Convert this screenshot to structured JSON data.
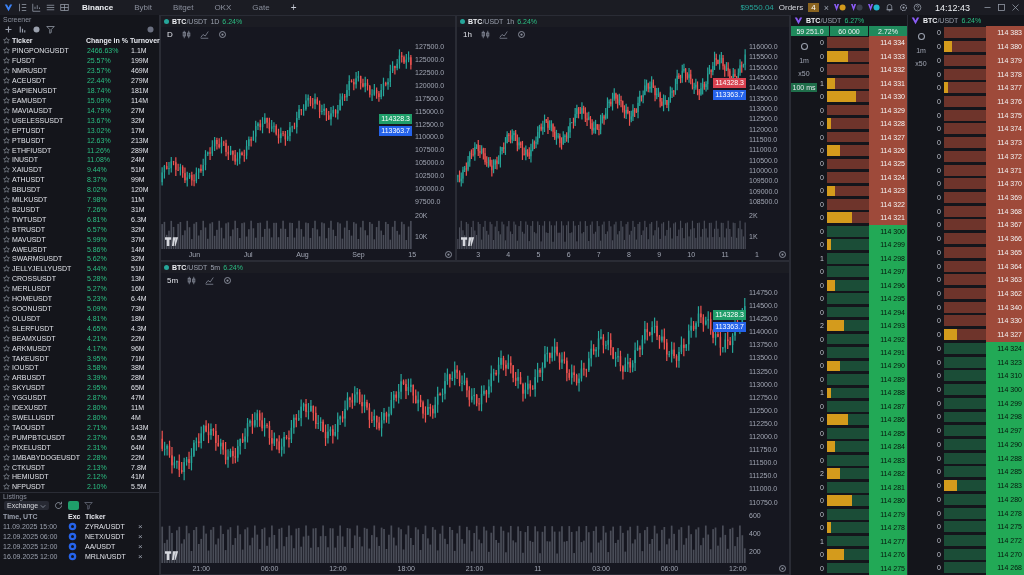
{
  "top_bar": {
    "tabs": [
      {
        "label": "Binance",
        "selected": true
      },
      {
        "label": "Bybit",
        "selected": false
      },
      {
        "label": "Bitget",
        "selected": false
      },
      {
        "label": "OKX",
        "selected": false
      },
      {
        "label": "Gate",
        "selected": false
      }
    ],
    "add_tab": "+",
    "balance": "$9550.04",
    "orders_label": "Orders",
    "orders_count": "4",
    "orders_close": "×",
    "clock": "14:12:43"
  },
  "screener": {
    "title": "Screener",
    "columns": [
      "Ticker",
      "Change in %",
      "Turnover"
    ],
    "rows": [
      {
        "ticker": "PINGPONGUSDT",
        "change": "2466.63%",
        "turnover": "1.1M"
      },
      {
        "ticker": "FUSDT",
        "change": "25.57%",
        "turnover": "199M"
      },
      {
        "ticker": "NMRUSDT",
        "change": "23.57%",
        "turnover": "469M"
      },
      {
        "ticker": "ACEUSDT",
        "change": "22.44%",
        "turnover": "279M"
      },
      {
        "ticker": "SAPIENUSDT",
        "change": "18.74%",
        "turnover": "181M"
      },
      {
        "ticker": "EAMUSDT",
        "change": "15.09%",
        "turnover": "114M"
      },
      {
        "ticker": "MAVIAUSDT",
        "change": "14.79%",
        "turnover": "27M"
      },
      {
        "ticker": "USELESSUSDT",
        "change": "13.67%",
        "turnover": "32M"
      },
      {
        "ticker": "EPTUSDT",
        "change": "13.02%",
        "turnover": "17M"
      },
      {
        "ticker": "PTBUSDT",
        "change": "12.63%",
        "turnover": "213M"
      },
      {
        "ticker": "ETHFIUSDT",
        "change": "11.26%",
        "turnover": "289M"
      },
      {
        "ticker": "INUSDT",
        "change": "11.08%",
        "turnover": "24M"
      },
      {
        "ticker": "XAIUSDT",
        "change": "9.44%",
        "turnover": "51M"
      },
      {
        "ticker": "ATHUSDT",
        "change": "8.37%",
        "turnover": "99M"
      },
      {
        "ticker": "BBUSDT",
        "change": "8.02%",
        "turnover": "120M"
      },
      {
        "ticker": "MILKUSDT",
        "change": "7.98%",
        "turnover": "11M"
      },
      {
        "ticker": "B2USDT",
        "change": "7.26%",
        "turnover": "31M"
      },
      {
        "ticker": "TWTUSDT",
        "change": "6.81%",
        "turnover": "6.3M"
      },
      {
        "ticker": "BTRUSDT",
        "change": "6.57%",
        "turnover": "32M"
      },
      {
        "ticker": "MAVUSDT",
        "change": "5.99%",
        "turnover": "37M"
      },
      {
        "ticker": "AWEUSDT",
        "change": "5.86%",
        "turnover": "14M"
      },
      {
        "ticker": "SWARMSUSDT",
        "change": "5.62%",
        "turnover": "32M"
      },
      {
        "ticker": "JELLYJELLYUSDT",
        "change": "5.44%",
        "turnover": "51M"
      },
      {
        "ticker": "CROSSUSDT",
        "change": "5.28%",
        "turnover": "13M"
      },
      {
        "ticker": "MERLUSDT",
        "change": "5.27%",
        "turnover": "16M"
      },
      {
        "ticker": "HOMEUSDT",
        "change": "5.23%",
        "turnover": "6.4M"
      },
      {
        "ticker": "SOONUSDT",
        "change": "5.09%",
        "turnover": "73M"
      },
      {
        "ticker": "OLUSDT",
        "change": "4.81%",
        "turnover": "18M"
      },
      {
        "ticker": "SLERFUSDT",
        "change": "4.65%",
        "turnover": "4.3M"
      },
      {
        "ticker": "BEAMXUSDT",
        "change": "4.21%",
        "turnover": "22M"
      },
      {
        "ticker": "ARKMUSDT",
        "change": "4.17%",
        "turnover": "96M"
      },
      {
        "ticker": "TAKEUSDT",
        "change": "3.95%",
        "turnover": "71M"
      },
      {
        "ticker": "IOUSDT",
        "change": "3.58%",
        "turnover": "38M"
      },
      {
        "ticker": "ARBUSDT",
        "change": "3.39%",
        "turnover": "28M"
      },
      {
        "ticker": "SKYUSDT",
        "change": "2.95%",
        "turnover": "65M"
      },
      {
        "ticker": "YGGUSDT",
        "change": "2.87%",
        "turnover": "47M"
      },
      {
        "ticker": "IDEXUSDT",
        "change": "2.80%",
        "turnover": "11M"
      },
      {
        "ticker": "SWELLUSDT",
        "change": "2.80%",
        "turnover": "4M"
      },
      {
        "ticker": "TAOUSDT",
        "change": "2.71%",
        "turnover": "143M"
      },
      {
        "ticker": "PUMPBTCUSDT",
        "change": "2.37%",
        "turnover": "6.5M"
      },
      {
        "ticker": "PIXELUSDT",
        "change": "2.31%",
        "turnover": "64M"
      },
      {
        "ticker": "1MBABYDOGEUSDT",
        "change": "2.28%",
        "turnover": "22M"
      },
      {
        "ticker": "CTKUSDT",
        "change": "2.13%",
        "turnover": "7.8M"
      },
      {
        "ticker": "HEMIUSDT",
        "change": "2.12%",
        "turnover": "41M"
      },
      {
        "ticker": "NFPUSDT",
        "change": "2.10%",
        "turnover": "5.5M"
      }
    ]
  },
  "listings": {
    "title": "Listings",
    "exchange_select": "Exchange",
    "columns": [
      "Time, UTC",
      "Exc",
      "Ticker"
    ],
    "rows": [
      {
        "time": "11.09.2025 15:00",
        "pair": "ZYRA/USDT",
        "remove": "×"
      },
      {
        "time": "12.09.2025 06:00",
        "pair": "NETX/USDT",
        "remove": "×"
      },
      {
        "time": "12.09.2025 12:00",
        "pair": "AA/USDT",
        "remove": "×"
      },
      {
        "time": "16.09.2025 12:00",
        "pair": "MRLN/USDT",
        "remove": "×"
      }
    ]
  },
  "charts": [
    {
      "symbol": "BTC",
      "quote": "/USDT",
      "interval": "1D",
      "change": "6.24%",
      "timeframe": "D",
      "last_price": "114328.3",
      "price_up": true,
      "mark_price": "113363.7",
      "price_ticks": [
        "127500.0",
        "125000.0",
        "122500.0",
        "120000.0",
        "117500.0",
        "115000.0",
        "112500.0",
        "110000.0",
        "107500.0",
        "105000.0",
        "102500.0",
        "100000.0",
        "97500.0"
      ],
      "volume_ticks": [
        "20K",
        "10K"
      ],
      "time_ticks": [
        "Jun",
        "Jul",
        "Aug",
        "Sep",
        "15"
      ]
    },
    {
      "symbol": "BTC",
      "quote": "/USDT",
      "interval": "1h",
      "change": "6.24%",
      "timeframe": "1h",
      "last_price": "114328.3",
      "price_up": false,
      "mark_price": "113363.7",
      "price_ticks": [
        "116000.0",
        "115500.0",
        "115000.0",
        "114500.0",
        "114000.0",
        "113500.0",
        "113000.0",
        "112500.0",
        "112000.0",
        "111500.0",
        "111000.0",
        "110500.0",
        "110000.0",
        "109500.0",
        "109000.0",
        "108500.0"
      ],
      "volume_ticks": [
        "2K",
        "1K"
      ],
      "time_ticks": [
        "3",
        "4",
        "5",
        "6",
        "7",
        "8",
        "9",
        "10",
        "11",
        "1"
      ]
    },
    {
      "symbol": "BTC",
      "quote": "/USDT",
      "interval": "5m",
      "change": "6.24%",
      "timeframe": "5m",
      "last_price": "114328.3",
      "price_up": true,
      "mark_price": "113363.7",
      "price_ticks": [
        "114750.0",
        "114500.0",
        "114250.0",
        "114000.0",
        "113750.0",
        "113500.0",
        "113250.0",
        "113000.0",
        "112750.0",
        "112500.0",
        "112250.0",
        "112000.0",
        "111750.0",
        "111500.0",
        "111250.0",
        "111000.0",
        "110750.0"
      ],
      "volume_ticks": [
        "600",
        "400",
        "200"
      ],
      "time_ticks": [
        "21:00",
        "06:00",
        "12:00",
        "18:00",
        "21:00",
        "11",
        "03:00",
        "06:00",
        "12:00"
      ]
    }
  ],
  "order_books": [
    {
      "symbol": "BTC",
      "quote": "/USDT",
      "change": "6.27%",
      "stats": [
        "59 251.0",
        "60 000",
        "2.72%"
      ],
      "controls": [
        "1m",
        "x50",
        "100 ms"
      ],
      "asks": [
        {
          "qty": "0",
          "price": "114 334"
        },
        {
          "qty": "0",
          "price": "114 333",
          "level": 0.5
        },
        {
          "qty": "0",
          "price": "114 332"
        },
        {
          "qty": "1",
          "price": "114 331",
          "level": 0.2
        },
        {
          "qty": "0",
          "price": "114 330",
          "level": 0.7
        },
        {
          "qty": "0",
          "price": "114 329"
        },
        {
          "qty": "0",
          "price": "114 328",
          "level": 0.1
        },
        {
          "qty": "0",
          "price": "114 327"
        },
        {
          "qty": "0",
          "price": "114 326",
          "level": 0.3
        },
        {
          "qty": "0",
          "price": "114 325"
        },
        {
          "qty": "0",
          "price": "114 324"
        },
        {
          "qty": "0",
          "price": "114 323",
          "level": 0.2
        },
        {
          "qty": "0",
          "price": "114 322"
        },
        {
          "qty": "0",
          "price": "114 321",
          "level": 0.6
        }
      ],
      "bids": [
        {
          "qty": "0",
          "price": "114 300"
        },
        {
          "qty": "0",
          "price": "114 299",
          "level": 0.1
        },
        {
          "qty": "1",
          "price": "114 298"
        },
        {
          "qty": "0",
          "price": "114 297"
        },
        {
          "qty": "0",
          "price": "114 296",
          "level": 0.2
        },
        {
          "qty": "0",
          "price": "114 295"
        },
        {
          "qty": "0",
          "price": "114 294"
        },
        {
          "qty": "2",
          "price": "114 293",
          "level": 0.4
        },
        {
          "qty": "0",
          "price": "114 292"
        },
        {
          "qty": "0",
          "price": "114 291"
        },
        {
          "qty": "0",
          "price": "114 290",
          "level": 0.3
        },
        {
          "qty": "0",
          "price": "114 289"
        },
        {
          "qty": "1",
          "price": "114 288",
          "level": 0.1
        },
        {
          "qty": "0",
          "price": "114 287"
        },
        {
          "qty": "0",
          "price": "114 286",
          "level": 0.5
        },
        {
          "qty": "0",
          "price": "114 285"
        },
        {
          "qty": "0",
          "price": "114 284",
          "level": 0.2
        },
        {
          "qty": "0",
          "price": "114 283"
        },
        {
          "qty": "2",
          "price": "114 282",
          "level": 0.3
        },
        {
          "qty": "0",
          "price": "114 281"
        },
        {
          "qty": "0",
          "price": "114 280",
          "level": 0.6
        },
        {
          "qty": "0",
          "price": "114 279"
        },
        {
          "qty": "0",
          "price": "114 278",
          "level": 0.1
        },
        {
          "qty": "1",
          "price": "114 277"
        },
        {
          "qty": "0",
          "price": "114 276",
          "level": 0.4
        },
        {
          "qty": "0",
          "price": "114 275"
        }
      ]
    },
    {
      "symbol": "BTC",
      "quote": "/USDT",
      "change": "6.24%",
      "controls": [
        "1m",
        "x50"
      ],
      "asks": [
        {
          "qty": "0",
          "price": "114 383"
        },
        {
          "qty": "0",
          "price": "114 380",
          "level": 0.2
        },
        {
          "qty": "0",
          "price": "114 379"
        },
        {
          "qty": "0",
          "price": "114 378"
        },
        {
          "qty": "0",
          "price": "114 377",
          "level": 0.1
        },
        {
          "qty": "0",
          "price": "114 376"
        },
        {
          "qty": "0",
          "price": "114 375"
        },
        {
          "qty": "0",
          "price": "114 374"
        },
        {
          "qty": "0",
          "price": "114 373"
        },
        {
          "qty": "0",
          "price": "114 372"
        },
        {
          "qty": "0",
          "price": "114 371"
        },
        {
          "qty": "0",
          "price": "114 370"
        },
        {
          "qty": "0",
          "price": "114 369"
        },
        {
          "qty": "0",
          "price": "114 368"
        },
        {
          "qty": "0",
          "price": "114 367"
        },
        {
          "qty": "0",
          "price": "114 366"
        },
        {
          "qty": "0",
          "price": "114 365"
        },
        {
          "qty": "0",
          "price": "114 364"
        },
        {
          "qty": "0",
          "price": "114 363"
        },
        {
          "qty": "0",
          "price": "114 362"
        },
        {
          "qty": "0",
          "price": "114 340"
        },
        {
          "qty": "0",
          "price": "114 330"
        },
        {
          "qty": "0",
          "price": "114 327",
          "level": 0.3
        }
      ],
      "bids": [
        {
          "qty": "0",
          "price": "114 324"
        },
        {
          "qty": "0",
          "price": "114 323"
        },
        {
          "qty": "0",
          "price": "114 310"
        },
        {
          "qty": "0",
          "price": "114 300"
        },
        {
          "qty": "0",
          "price": "114 299"
        },
        {
          "qty": "0",
          "price": "114 298"
        },
        {
          "qty": "0",
          "price": "114 297"
        },
        {
          "qty": "0",
          "price": "114 290"
        },
        {
          "qty": "0",
          "price": "114 288"
        },
        {
          "qty": "0",
          "price": "114 285"
        },
        {
          "qty": "0",
          "price": "114 283",
          "level": 0.3
        },
        {
          "qty": "0",
          "price": "114 280"
        },
        {
          "qty": "0",
          "price": "114 278"
        },
        {
          "qty": "0",
          "price": "114 275"
        },
        {
          "qty": "0",
          "price": "114 272"
        },
        {
          "qty": "0",
          "price": "114 270"
        },
        {
          "qty": "0",
          "price": "114 268"
        }
      ]
    }
  ]
}
